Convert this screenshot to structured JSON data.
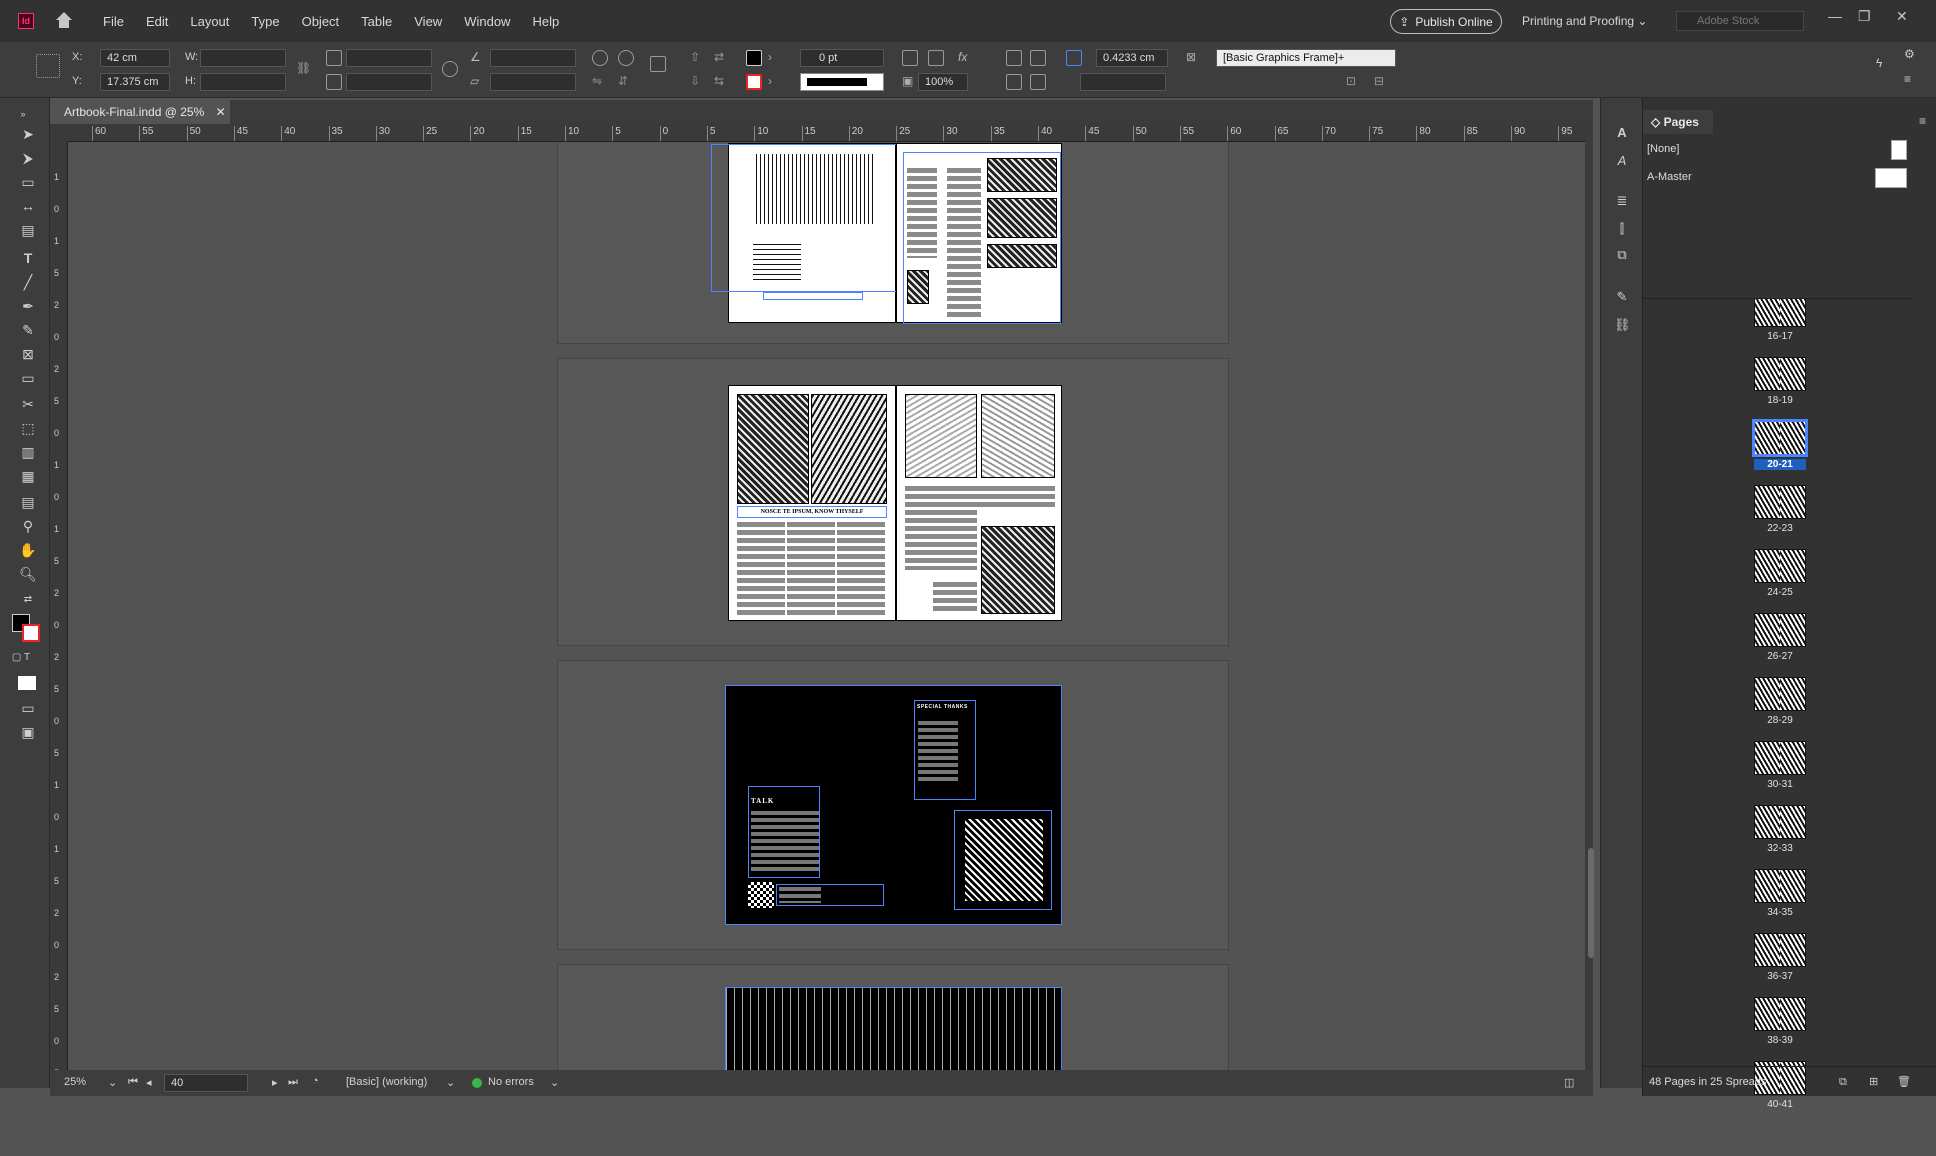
{
  "app": {
    "logo": "Id"
  },
  "menu": [
    "File",
    "Edit",
    "Layout",
    "Type",
    "Object",
    "Table",
    "View",
    "Window",
    "Help"
  ],
  "header": {
    "publish_label": "Publish Online",
    "workspace": "Printing and Proofing",
    "stock_placeholder": "Adobe Stock"
  },
  "control": {
    "x_label": "X:",
    "x_value": "42 cm",
    "y_label": "Y:",
    "y_value": "17.375 cm",
    "w_label": "W:",
    "h_label": "H:",
    "stroke_weight": "0 pt",
    "scale": "100%",
    "ref_value": "0.4233 cm",
    "object_style": "[Basic Graphics Frame]+"
  },
  "document": {
    "tab_title": "Artbook-Final.indd @ 25%"
  },
  "ruler": {
    "h_ticks": [
      "60",
      "55",
      "50",
      "45",
      "40",
      "35",
      "30",
      "25",
      "20",
      "15",
      "10",
      "5",
      "0",
      "5",
      "10",
      "15",
      "20",
      "25",
      "30",
      "35",
      "40",
      "45",
      "50",
      "55",
      "60",
      "65",
      "70",
      "75",
      "80",
      "85",
      "90",
      "95"
    ],
    "v_ticks": [
      "1",
      "0",
      "1",
      "5",
      "2",
      "0",
      "2",
      "5",
      "0",
      "1",
      "0",
      "1",
      "5",
      "2",
      "0",
      "2",
      "5",
      "0",
      "5",
      "1",
      "0",
      "1",
      "5",
      "2",
      "0",
      "2",
      "5",
      "0",
      "5"
    ]
  },
  "canvas": {
    "spread2_heading": "NOSCE TE IPSUM, KNOW THYSELF",
    "spread3_heading": "SPECIAL THANKS",
    "spread3_talk": "TALK"
  },
  "status": {
    "zoom": "25%",
    "page": "40",
    "style": "[Basic] (working)",
    "errors": "No errors"
  },
  "pages_panel": {
    "title": "Pages",
    "none_label": "[None]",
    "master_label": "A-Master",
    "spreads": [
      "16-17",
      "18-19",
      "20-21",
      "22-23",
      "24-25",
      "26-27",
      "28-29",
      "30-31",
      "32-33",
      "34-35",
      "36-37",
      "38-39",
      "40-41"
    ],
    "selected": "20-21",
    "footer": "48 Pages in 25 Spreads"
  },
  "colors": {
    "accent": "#4a84ff",
    "selected": "#1f5fbf"
  }
}
